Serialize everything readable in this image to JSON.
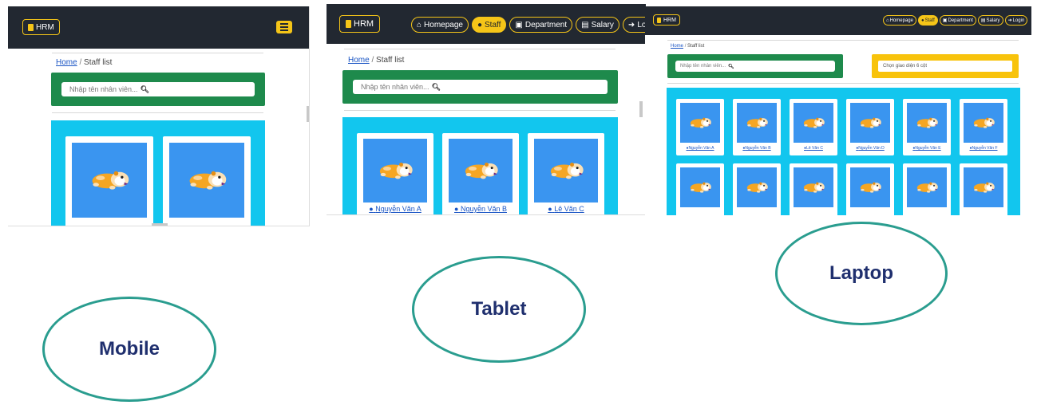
{
  "brand": "HRM",
  "nav": {
    "homepage": "Homepage",
    "staff": "Staff",
    "department": "Department",
    "salary": "Salary",
    "login": "Login"
  },
  "breadcrumb": {
    "home": "Home",
    "separator": "/",
    "current": "Staff list"
  },
  "search": {
    "placeholder": "Nhập tên nhân viên..."
  },
  "layout_select": {
    "value": "Chọn giao diện 6 cột"
  },
  "staff_names": [
    "Nguyễn Văn A",
    "Nguyễn Văn B",
    "Lê Văn C",
    "Nguyễn Văn D",
    "Nguyễn Văn E",
    "Nguyễn Văn F"
  ],
  "labels": {
    "mobile": "Mobile",
    "tablet": "Tablet",
    "laptop": "Laptop"
  },
  "colors": {
    "navbar": "#222831",
    "accent_yellow": "#f5c518",
    "search_panel_green": "#1e8a4c",
    "grid_panel_cyan": "#12c6ee",
    "card_image_blue": "#3a95f0",
    "label_circle_teal": "#2a9d8f",
    "label_text_navy": "#1f2f6e"
  },
  "icons": {
    "brand": "database-icon",
    "homepage": "home-icon",
    "staff": "user-circle-icon",
    "department": "id-card-icon",
    "salary": "money-icon",
    "login": "sign-in-icon",
    "search": "magnifier-icon",
    "menu": "hamburger-icon",
    "staff_photo": "running-hamster-icon"
  }
}
